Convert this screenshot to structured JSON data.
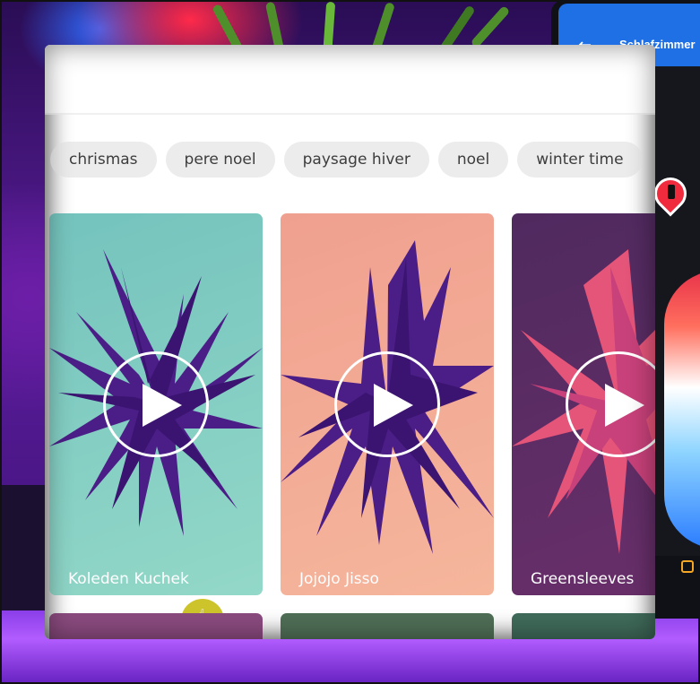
{
  "background": {
    "phone": {
      "room_title": "Schlafzimmer",
      "back_icon": "arrow-left-icon",
      "header_color": "#1f6fe5"
    }
  },
  "app": {
    "tags": [
      {
        "label": "chrismas"
      },
      {
        "label": "pere noel"
      },
      {
        "label": "paysage hiver"
      },
      {
        "label": "noel"
      },
      {
        "label": "winter time"
      }
    ],
    "cards": [
      {
        "title": "Koleden Kuchek",
        "bg_from": "#6ec3b9",
        "bg_to": "#8fd8c8",
        "art_color": "#4b1d86"
      },
      {
        "title": "Jojojo Jisso",
        "bg_from": "#f2a08e",
        "bg_to": "#f6b49a",
        "art_color": "#4b1d86"
      },
      {
        "title": "Greensleeves",
        "bg_from": "#5a2a6a",
        "bg_to": "#6b2f6f",
        "art_color": "#e8537a"
      }
    ],
    "row2_colors": [
      "#8a4a7e",
      "#4f6e56",
      "#3f6a5a"
    ],
    "icons": {
      "play": "play-icon",
      "cursor": "hand-pointer-icon"
    }
  }
}
